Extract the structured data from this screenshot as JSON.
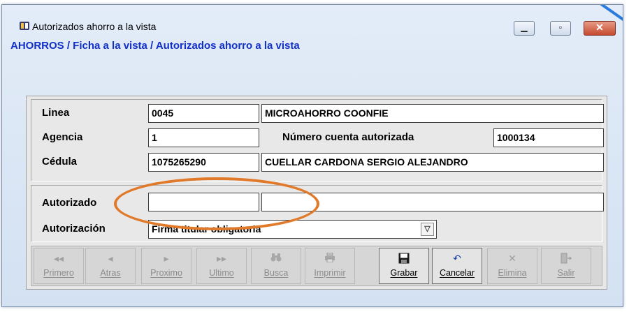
{
  "window": {
    "title": "Autorizados ahorro a la vista",
    "breadcrumb": "AHORROS / Ficha a la vista / Autorizados ahorro a la vista"
  },
  "form": {
    "linea": {
      "label": "Linea",
      "code": "0045",
      "name": "MICROAHORRO COONFIE"
    },
    "agencia": {
      "label": "Agencia",
      "value": "1"
    },
    "cuenta": {
      "label": "Número cuenta autorizada",
      "value": "1000134"
    },
    "cedula": {
      "label": "Cédula",
      "value": "1075265290",
      "name": "CUELLAR CARDONA SERGIO ALEJANDRO"
    },
    "autorizado": {
      "label": "Autorizado",
      "code": "",
      "name": ""
    },
    "autorizacion": {
      "label": "Autorización",
      "value": "Firma titular obligatoria"
    }
  },
  "toolbar": {
    "buttons": [
      {
        "label": "Primero",
        "icon": "first-icon",
        "enabled": false
      },
      {
        "label": "Atras",
        "icon": "previous-icon",
        "enabled": false
      },
      {
        "label": "Proximo",
        "icon": "next-icon",
        "enabled": false
      },
      {
        "label": "Ultimo",
        "icon": "last-icon",
        "enabled": false
      },
      {
        "label": "Busca",
        "icon": "binoculars-icon",
        "enabled": false
      },
      {
        "label": "Imprimir",
        "icon": "printer-icon",
        "enabled": false
      },
      {
        "label": "Grabar",
        "icon": "save-icon",
        "enabled": true
      },
      {
        "label": "Cancelar",
        "icon": "undo-icon",
        "enabled": true
      },
      {
        "label": "Elimina",
        "icon": "delete-icon",
        "enabled": false
      },
      {
        "label": "Salir",
        "icon": "exit-icon",
        "enabled": false
      }
    ]
  },
  "colors": {
    "breadcrumb": "#1030c8",
    "highlight_oval": "#e07a2a",
    "close_button": "#c44a2e"
  }
}
